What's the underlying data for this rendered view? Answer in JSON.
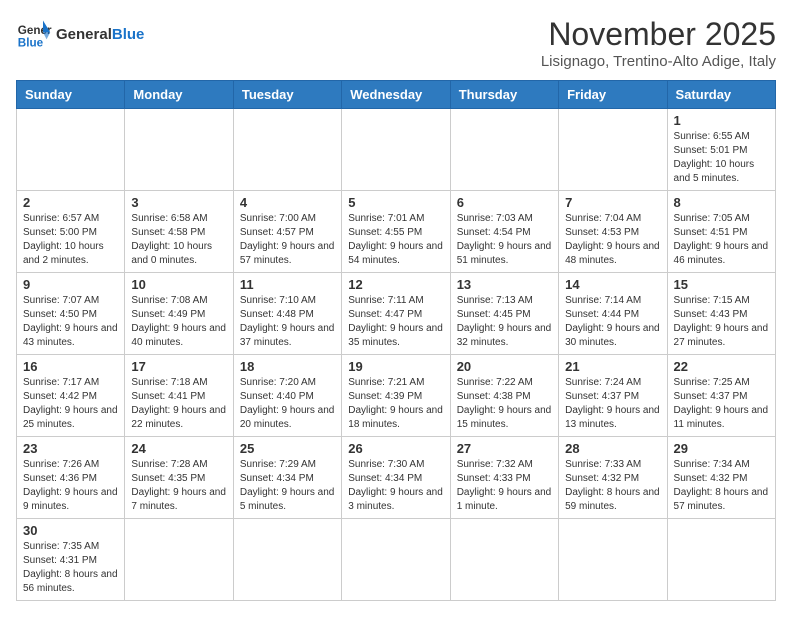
{
  "header": {
    "logo_general": "General",
    "logo_blue": "Blue",
    "month_title": "November 2025",
    "location": "Lisignago, Trentino-Alto Adige, Italy"
  },
  "weekdays": [
    "Sunday",
    "Monday",
    "Tuesday",
    "Wednesday",
    "Thursday",
    "Friday",
    "Saturday"
  ],
  "weeks": [
    [
      {
        "day": "",
        "info": ""
      },
      {
        "day": "",
        "info": ""
      },
      {
        "day": "",
        "info": ""
      },
      {
        "day": "",
        "info": ""
      },
      {
        "day": "",
        "info": ""
      },
      {
        "day": "",
        "info": ""
      },
      {
        "day": "1",
        "info": "Sunrise: 6:55 AM\nSunset: 5:01 PM\nDaylight: 10 hours and 5 minutes."
      }
    ],
    [
      {
        "day": "2",
        "info": "Sunrise: 6:57 AM\nSunset: 5:00 PM\nDaylight: 10 hours and 2 minutes."
      },
      {
        "day": "3",
        "info": "Sunrise: 6:58 AM\nSunset: 4:58 PM\nDaylight: 10 hours and 0 minutes."
      },
      {
        "day": "4",
        "info": "Sunrise: 7:00 AM\nSunset: 4:57 PM\nDaylight: 9 hours and 57 minutes."
      },
      {
        "day": "5",
        "info": "Sunrise: 7:01 AM\nSunset: 4:55 PM\nDaylight: 9 hours and 54 minutes."
      },
      {
        "day": "6",
        "info": "Sunrise: 7:03 AM\nSunset: 4:54 PM\nDaylight: 9 hours and 51 minutes."
      },
      {
        "day": "7",
        "info": "Sunrise: 7:04 AM\nSunset: 4:53 PM\nDaylight: 9 hours and 48 minutes."
      },
      {
        "day": "8",
        "info": "Sunrise: 7:05 AM\nSunset: 4:51 PM\nDaylight: 9 hours and 46 minutes."
      }
    ],
    [
      {
        "day": "9",
        "info": "Sunrise: 7:07 AM\nSunset: 4:50 PM\nDaylight: 9 hours and 43 minutes."
      },
      {
        "day": "10",
        "info": "Sunrise: 7:08 AM\nSunset: 4:49 PM\nDaylight: 9 hours and 40 minutes."
      },
      {
        "day": "11",
        "info": "Sunrise: 7:10 AM\nSunset: 4:48 PM\nDaylight: 9 hours and 37 minutes."
      },
      {
        "day": "12",
        "info": "Sunrise: 7:11 AM\nSunset: 4:47 PM\nDaylight: 9 hours and 35 minutes."
      },
      {
        "day": "13",
        "info": "Sunrise: 7:13 AM\nSunset: 4:45 PM\nDaylight: 9 hours and 32 minutes."
      },
      {
        "day": "14",
        "info": "Sunrise: 7:14 AM\nSunset: 4:44 PM\nDaylight: 9 hours and 30 minutes."
      },
      {
        "day": "15",
        "info": "Sunrise: 7:15 AM\nSunset: 4:43 PM\nDaylight: 9 hours and 27 minutes."
      }
    ],
    [
      {
        "day": "16",
        "info": "Sunrise: 7:17 AM\nSunset: 4:42 PM\nDaylight: 9 hours and 25 minutes."
      },
      {
        "day": "17",
        "info": "Sunrise: 7:18 AM\nSunset: 4:41 PM\nDaylight: 9 hours and 22 minutes."
      },
      {
        "day": "18",
        "info": "Sunrise: 7:20 AM\nSunset: 4:40 PM\nDaylight: 9 hours and 20 minutes."
      },
      {
        "day": "19",
        "info": "Sunrise: 7:21 AM\nSunset: 4:39 PM\nDaylight: 9 hours and 18 minutes."
      },
      {
        "day": "20",
        "info": "Sunrise: 7:22 AM\nSunset: 4:38 PM\nDaylight: 9 hours and 15 minutes."
      },
      {
        "day": "21",
        "info": "Sunrise: 7:24 AM\nSunset: 4:37 PM\nDaylight: 9 hours and 13 minutes."
      },
      {
        "day": "22",
        "info": "Sunrise: 7:25 AM\nSunset: 4:37 PM\nDaylight: 9 hours and 11 minutes."
      }
    ],
    [
      {
        "day": "23",
        "info": "Sunrise: 7:26 AM\nSunset: 4:36 PM\nDaylight: 9 hours and 9 minutes."
      },
      {
        "day": "24",
        "info": "Sunrise: 7:28 AM\nSunset: 4:35 PM\nDaylight: 9 hours and 7 minutes."
      },
      {
        "day": "25",
        "info": "Sunrise: 7:29 AM\nSunset: 4:34 PM\nDaylight: 9 hours and 5 minutes."
      },
      {
        "day": "26",
        "info": "Sunrise: 7:30 AM\nSunset: 4:34 PM\nDaylight: 9 hours and 3 minutes."
      },
      {
        "day": "27",
        "info": "Sunrise: 7:32 AM\nSunset: 4:33 PM\nDaylight: 9 hours and 1 minute."
      },
      {
        "day": "28",
        "info": "Sunrise: 7:33 AM\nSunset: 4:32 PM\nDaylight: 8 hours and 59 minutes."
      },
      {
        "day": "29",
        "info": "Sunrise: 7:34 AM\nSunset: 4:32 PM\nDaylight: 8 hours and 57 minutes."
      }
    ],
    [
      {
        "day": "30",
        "info": "Sunrise: 7:35 AM\nSunset: 4:31 PM\nDaylight: 8 hours and 56 minutes."
      },
      {
        "day": "",
        "info": ""
      },
      {
        "day": "",
        "info": ""
      },
      {
        "day": "",
        "info": ""
      },
      {
        "day": "",
        "info": ""
      },
      {
        "day": "",
        "info": ""
      },
      {
        "day": "",
        "info": ""
      }
    ]
  ]
}
